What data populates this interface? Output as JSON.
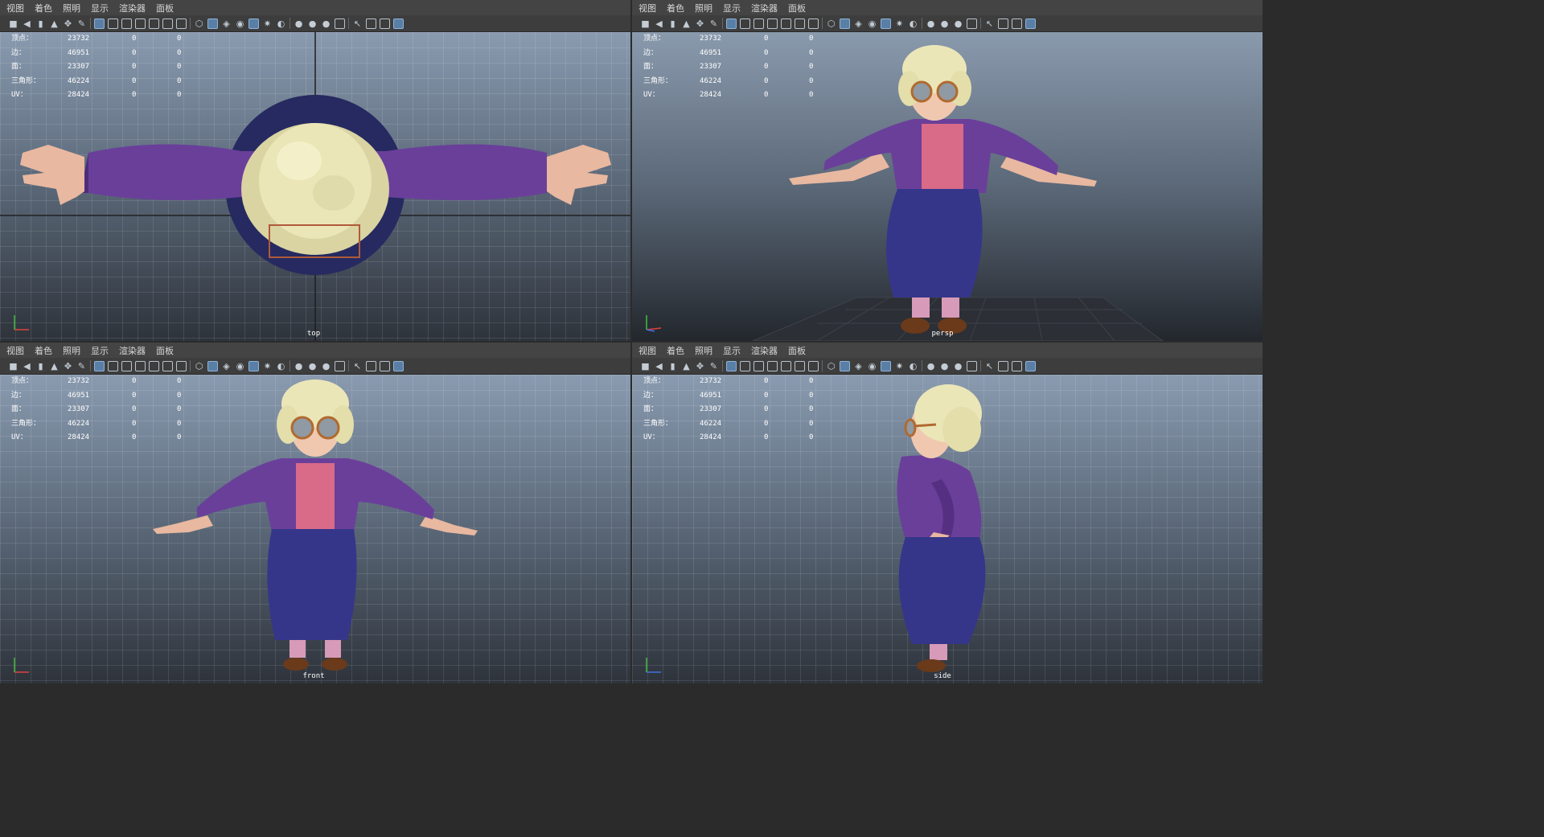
{
  "menu": [
    "视图",
    "着色",
    "照明",
    "显示",
    "渲染器",
    "面板"
  ],
  "hud": {
    "rows": [
      {
        "label": "顶点：",
        "value": "23732",
        "a": "0",
        "b": "0"
      },
      {
        "label": "边：",
        "value": "46951",
        "a": "0",
        "b": "0"
      },
      {
        "label": "面：",
        "value": "23307",
        "a": "0",
        "b": "0"
      },
      {
        "label": "三角形：",
        "value": "46224",
        "a": "0",
        "b": "0"
      },
      {
        "label": "UV：",
        "value": "28424",
        "a": "0",
        "b": "0"
      }
    ]
  },
  "panes": [
    {
      "camera": "top"
    },
    {
      "camera": "persp"
    },
    {
      "camera": "front"
    },
    {
      "camera": "side"
    }
  ],
  "colors": {
    "cardigan": "#6a3f9a",
    "shirt": "#d96a88",
    "skirt": "#35368a",
    "hair": "#e8e3b5",
    "skin": "#e8b8a0",
    "glasses": "#b06a30",
    "shoes": "#6a3a1a",
    "socks": "#d79ab8"
  }
}
